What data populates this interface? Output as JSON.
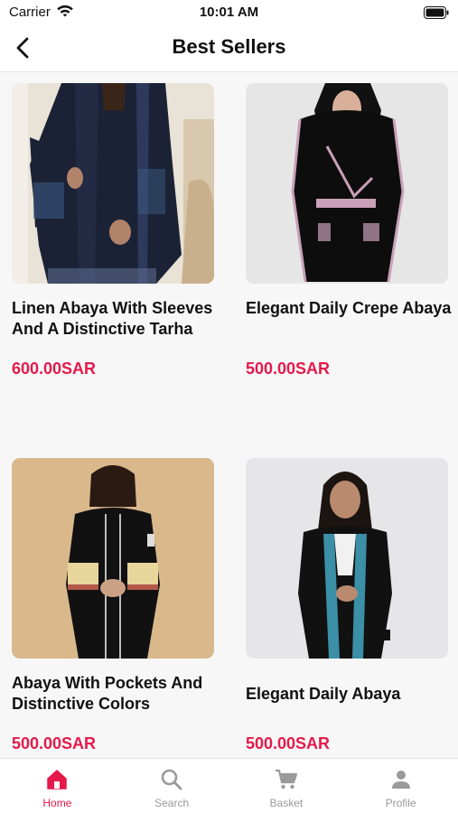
{
  "status_bar": {
    "carrier": "Carrier",
    "time": "10:01 AM"
  },
  "header": {
    "title": "Best Sellers"
  },
  "products": [
    {
      "name": "Linen Abaya With Sleeves And A Distinctive Tarha",
      "price": "600.00SAR"
    },
    {
      "name": "Elegant Daily Crepe Abaya",
      "price": "500.00SAR"
    },
    {
      "name": "Abaya With Pockets And Distinctive Colors",
      "price": "500.00SAR"
    },
    {
      "name": "Elegant Daily Abaya",
      "price": "500.00SAR"
    }
  ],
  "tabs": [
    {
      "label": "Home",
      "icon": "home-icon",
      "active": true
    },
    {
      "label": "Search",
      "icon": "search-icon",
      "active": false
    },
    {
      "label": "Basket",
      "icon": "cart-icon",
      "active": false
    },
    {
      "label": "Profile",
      "icon": "profile-icon",
      "active": false
    }
  ],
  "colors": {
    "accent": "#e5194a",
    "inactive_tab": "#9a9a9a"
  }
}
